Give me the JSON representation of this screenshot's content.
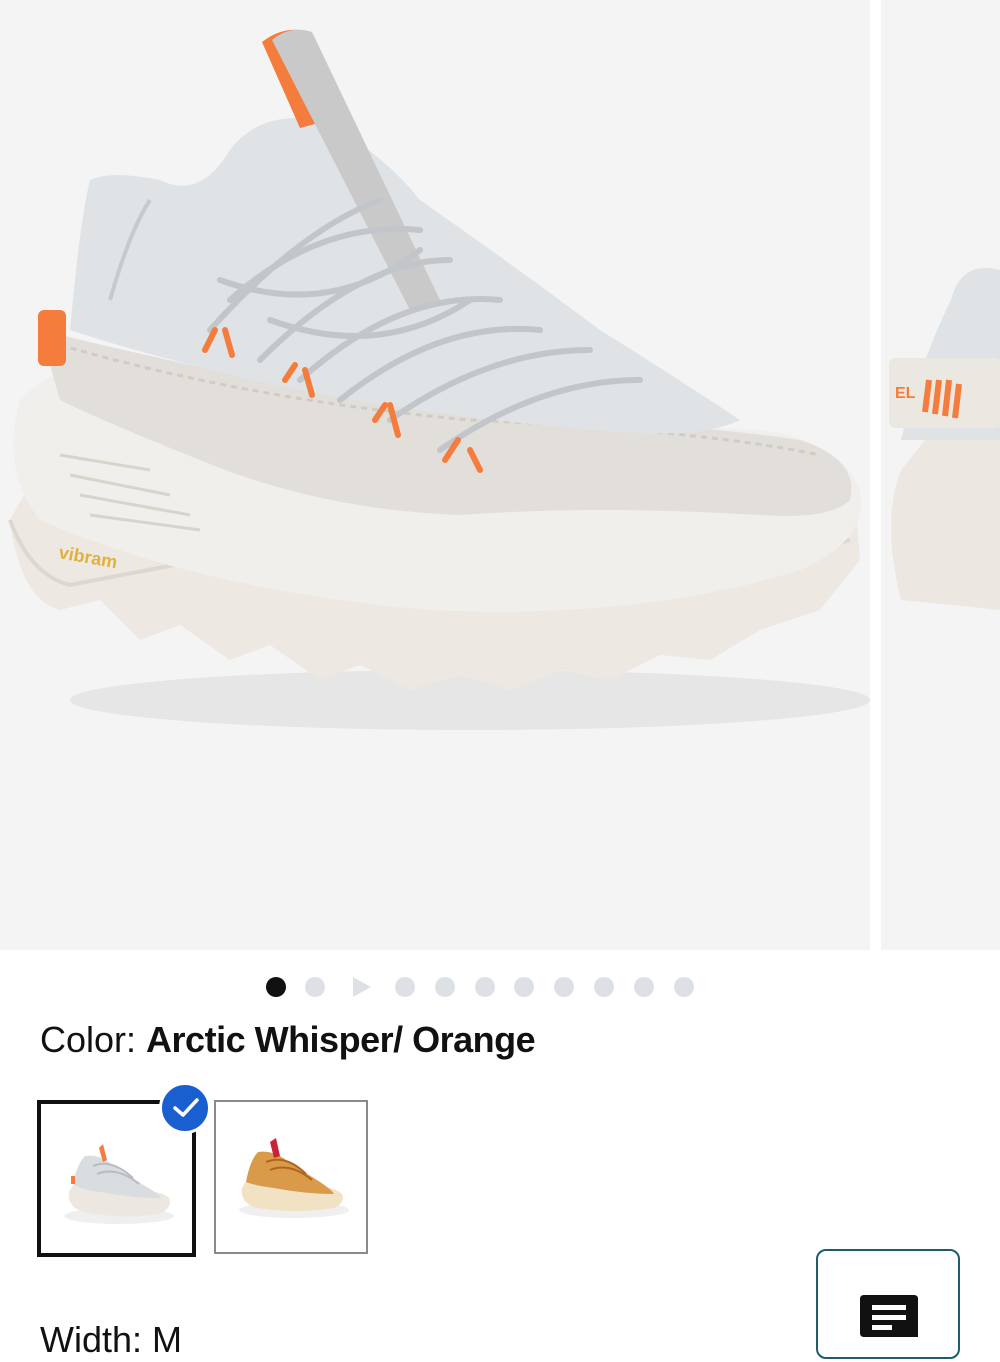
{
  "gallery": {
    "slide_count": 12,
    "active_slide_index": 0,
    "video_slide_index": 2
  },
  "color": {
    "label": "Color:",
    "value": "Arctic Whisper/ Orange",
    "swatches": [
      {
        "name": "Arctic Whisper/ Orange",
        "selected": true
      },
      {
        "name": "Tan/ Red",
        "selected": false
      }
    ]
  },
  "width": {
    "label": "Width: M"
  },
  "colors": {
    "dot_active": "#111111",
    "dot_inactive": "#dde1e6",
    "selected_check": "#1a5fd0",
    "chat_border": "#1f5d6b",
    "accent_orange": "#f47c3c"
  },
  "icons": {
    "selected": "checkmark-icon",
    "chat": "chat-icon",
    "video": "play-icon"
  }
}
